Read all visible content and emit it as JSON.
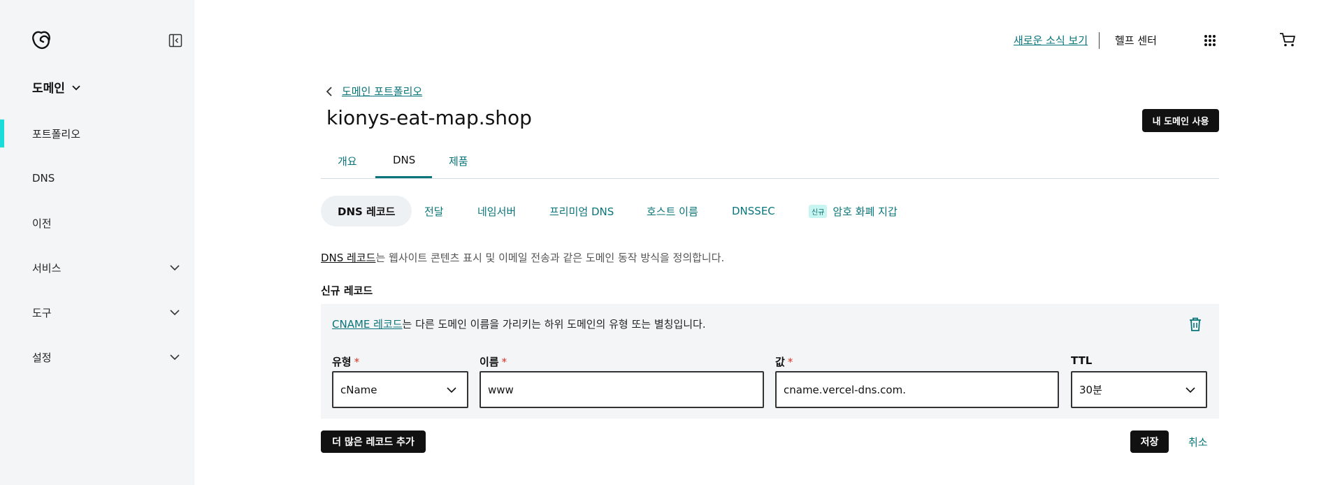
{
  "sidebar": {
    "logo_icon": "godaddy-logo-icon",
    "collapse_icon": "sidebar-collapse-icon",
    "product_switch": "도메인",
    "items": [
      {
        "label": "포트폴리오",
        "active": true
      },
      {
        "label": "DNS"
      },
      {
        "label": "이전"
      },
      {
        "label": "서비스",
        "expandable": true
      },
      {
        "label": "도구",
        "expandable": true
      },
      {
        "label": "설정",
        "expandable": true
      }
    ]
  },
  "header": {
    "news_link": "새로운 소식 보기",
    "help_center": "헬프 센터",
    "apps_icon": "grid-apps-icon",
    "cart_icon": "cart-icon"
  },
  "page": {
    "breadcrumb": "도메인 포트폴리오",
    "domain_name": "kionys-eat-map.shop",
    "use_domain_button": "내 도메인 사용",
    "tabs": [
      {
        "label": "개요"
      },
      {
        "label": "DNS",
        "active": true
      },
      {
        "label": "제품"
      }
    ],
    "subtabs": [
      {
        "label": "DNS 레코드",
        "active": true
      },
      {
        "label": "전달"
      },
      {
        "label": "네임서버"
      },
      {
        "label": "프리미엄 DNS"
      },
      {
        "label": "호스트 이름"
      },
      {
        "label": "DNSSEC"
      },
      {
        "label": "암호 화폐 지갑",
        "badge": "신규"
      }
    ],
    "description_link": "DNS 레코드",
    "description_text": "는 웹사이트 콘텐츠 표시 및 이메일 전송과 같은 도메인 동작 방식을 정의합니다.",
    "new_record_title": "신규 레코드",
    "record": {
      "desc_link": "CNAME 레코드",
      "desc_text": "는 다른 도메인 이름을 가리키는 하위 도메인의 유형 또는 별칭입니다.",
      "trash_icon": "trash-icon",
      "type_label": "유형",
      "type_value": "cName",
      "name_label": "이름",
      "name_value": "www",
      "value_label": "값",
      "value_value": "cname.vercel-dns.com.",
      "ttl_label": "TTL",
      "ttl_value": "30분",
      "required_mark": "*"
    },
    "add_more_button": "더 많은 레코드 추가",
    "save_button": "저장",
    "cancel_button": "취소"
  },
  "colors": {
    "accent": "#09757a",
    "active_indicator": "#1bdbdb",
    "sidebar_bg": "#f4f5f6",
    "button_dark": "#111111"
  }
}
